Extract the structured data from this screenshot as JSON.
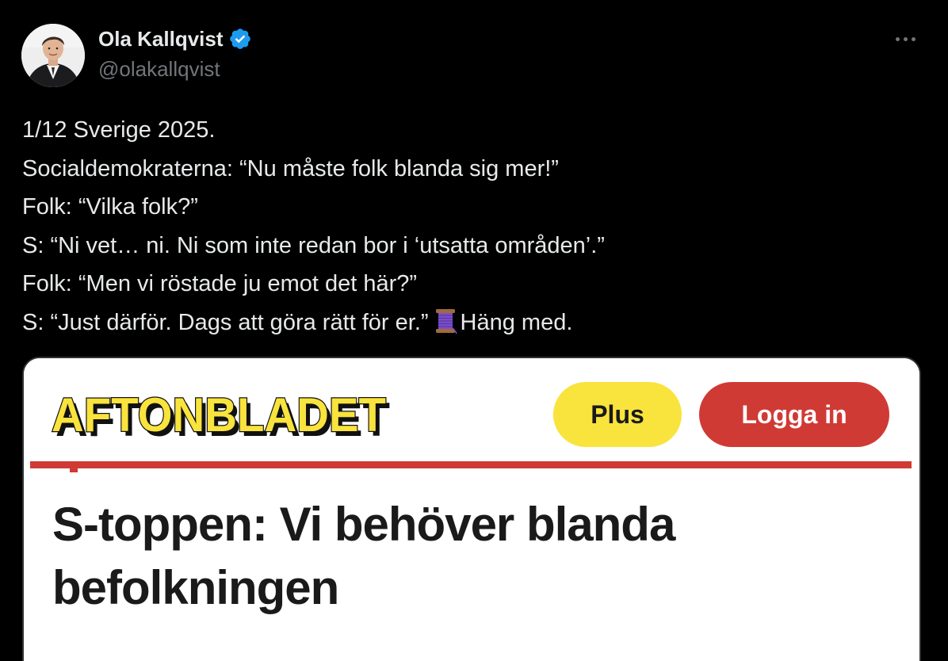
{
  "tweet": {
    "author": {
      "display_name": "Ola Kallqvist",
      "handle": "@olakallqvist",
      "verified": true,
      "avatar_icon": "profile-photo"
    },
    "more_icon": "more-options-icon",
    "text_lines": [
      "1/12 Sverige 2025.",
      "Socialdemokraterna: “Nu måste folk blanda sig mer!”",
      "Folk: “Vilka folk?”",
      "S: “Ni vet… ni. Ni som inte redan bor i ‘utsatta områden’.”",
      "Folk: “Men vi röstade ju emot det här?”",
      "S: “Just därför. Dags att göra rätt för er.”"
    ],
    "last_line_suffix": "Häng med.",
    "thread_emoji": "spool-of-thread-emoji"
  },
  "media": {
    "brand": "AFTONBLADET",
    "plus_label": "Plus",
    "login_label": "Logga in",
    "headline_lines": [
      "S-toppen: Vi behöver blanda",
      "befolkningen"
    ]
  },
  "colors": {
    "background": "#000000",
    "text_primary": "#e7e9ea",
    "text_secondary": "#71767b",
    "verified_blue": "#1d9bf0",
    "brand_yellow": "#f9e33d",
    "brand_red": "#d03a35",
    "headline": "#1a1a1a"
  }
}
